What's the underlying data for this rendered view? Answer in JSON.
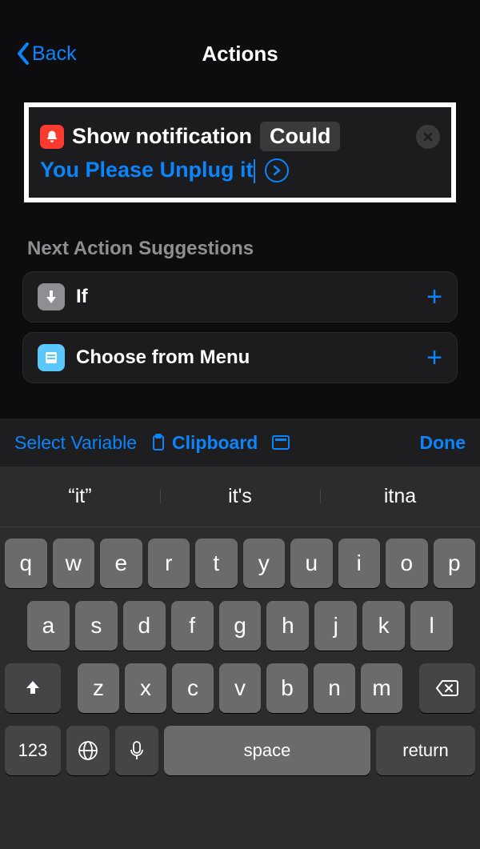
{
  "header": {
    "back_label": "Back",
    "title": "Actions"
  },
  "action_card": {
    "label": "Show notification",
    "param_pill": "Could",
    "input_text": "You Please Unplug it"
  },
  "suggestions": {
    "heading": "Next Action Suggestions",
    "items": [
      {
        "label": "If",
        "icon": "branch"
      },
      {
        "label": "Choose from Menu",
        "icon": "menu"
      }
    ]
  },
  "accessory": {
    "select_variable": "Select Variable",
    "clipboard": "Clipboard",
    "done": "Done"
  },
  "keyboard": {
    "predictions": [
      "“it”",
      "it's",
      "itna"
    ],
    "row1": [
      "q",
      "w",
      "e",
      "r",
      "t",
      "y",
      "u",
      "i",
      "o",
      "p"
    ],
    "row2": [
      "a",
      "s",
      "d",
      "f",
      "g",
      "h",
      "j",
      "k",
      "l"
    ],
    "row3": [
      "z",
      "x",
      "c",
      "v",
      "b",
      "n",
      "m"
    ],
    "num_label": "123",
    "space_label": "space",
    "return_label": "return"
  }
}
